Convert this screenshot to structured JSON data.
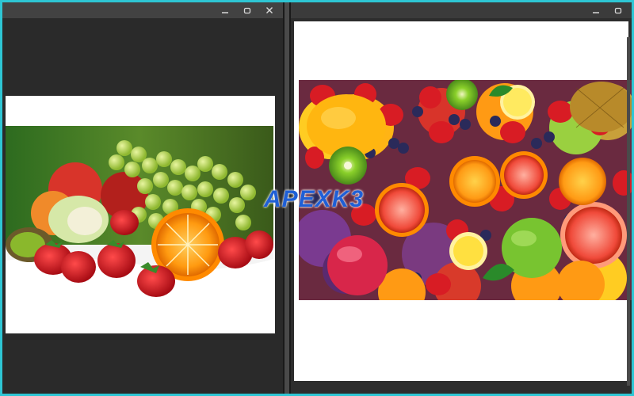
{
  "watermark": {
    "text": "APEXK3"
  },
  "left_window": {
    "controls": [
      {
        "name": "minimize",
        "icon": "minimize-icon"
      },
      {
        "name": "restore",
        "icon": "restore-icon"
      },
      {
        "name": "close",
        "icon": "close-icon"
      }
    ],
    "image": "fruit-photo-apples-grapes-orange-strawberries"
  },
  "right_window": {
    "controls": [
      {
        "name": "minimize",
        "icon": "minimize-icon"
      },
      {
        "name": "restore",
        "icon": "restore-icon"
      }
    ],
    "image": "fruit-photo-colorful-assortment"
  },
  "colors": {
    "frame_border": "#2ec6d4",
    "workspace": "#2a2a2a",
    "titlebar": "#424242",
    "watermark": "#1f5fd6"
  }
}
